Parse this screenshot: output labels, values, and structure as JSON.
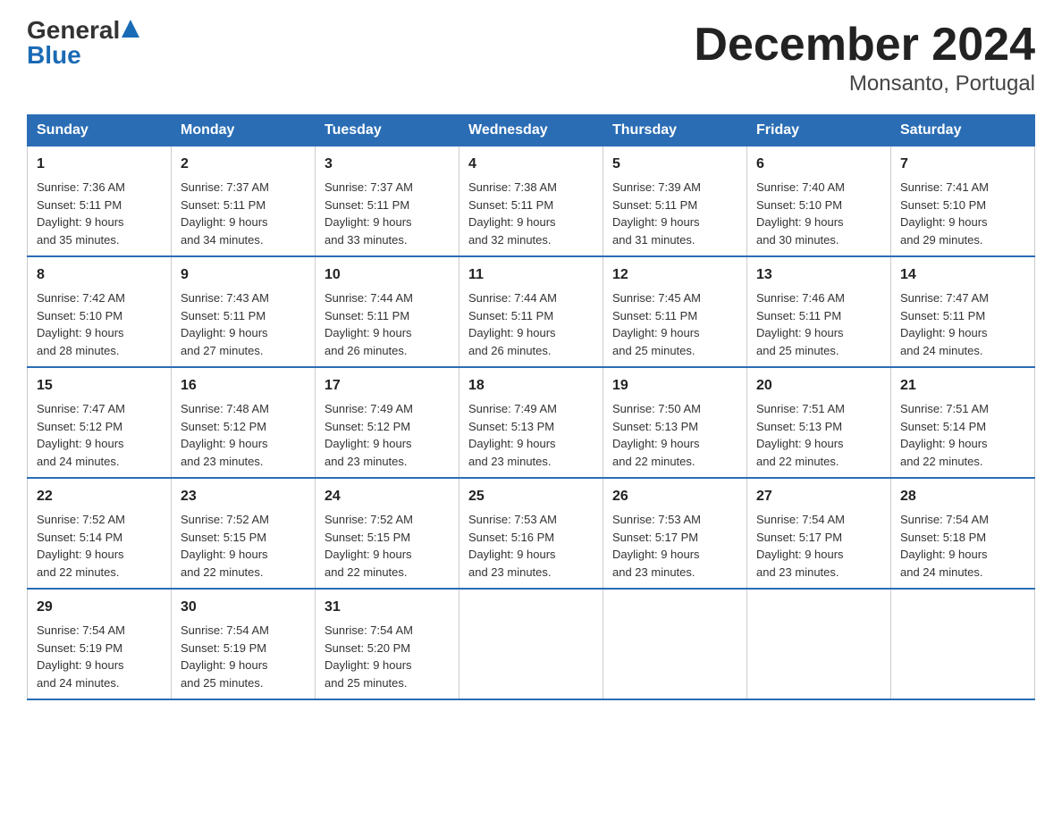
{
  "logo": {
    "general": "General",
    "blue": "Blue"
  },
  "title": "December 2024",
  "subtitle": "Monsanto, Portugal",
  "headers": [
    "Sunday",
    "Monday",
    "Tuesday",
    "Wednesday",
    "Thursday",
    "Friday",
    "Saturday"
  ],
  "weeks": [
    [
      {
        "day": "1",
        "sunrise": "7:36 AM",
        "sunset": "5:11 PM",
        "daylight": "9 hours and 35 minutes."
      },
      {
        "day": "2",
        "sunrise": "7:37 AM",
        "sunset": "5:11 PM",
        "daylight": "9 hours and 34 minutes."
      },
      {
        "day": "3",
        "sunrise": "7:37 AM",
        "sunset": "5:11 PM",
        "daylight": "9 hours and 33 minutes."
      },
      {
        "day": "4",
        "sunrise": "7:38 AM",
        "sunset": "5:11 PM",
        "daylight": "9 hours and 32 minutes."
      },
      {
        "day": "5",
        "sunrise": "7:39 AM",
        "sunset": "5:11 PM",
        "daylight": "9 hours and 31 minutes."
      },
      {
        "day": "6",
        "sunrise": "7:40 AM",
        "sunset": "5:10 PM",
        "daylight": "9 hours and 30 minutes."
      },
      {
        "day": "7",
        "sunrise": "7:41 AM",
        "sunset": "5:10 PM",
        "daylight": "9 hours and 29 minutes."
      }
    ],
    [
      {
        "day": "8",
        "sunrise": "7:42 AM",
        "sunset": "5:10 PM",
        "daylight": "9 hours and 28 minutes."
      },
      {
        "day": "9",
        "sunrise": "7:43 AM",
        "sunset": "5:11 PM",
        "daylight": "9 hours and 27 minutes."
      },
      {
        "day": "10",
        "sunrise": "7:44 AM",
        "sunset": "5:11 PM",
        "daylight": "9 hours and 26 minutes."
      },
      {
        "day": "11",
        "sunrise": "7:44 AM",
        "sunset": "5:11 PM",
        "daylight": "9 hours and 26 minutes."
      },
      {
        "day": "12",
        "sunrise": "7:45 AM",
        "sunset": "5:11 PM",
        "daylight": "9 hours and 25 minutes."
      },
      {
        "day": "13",
        "sunrise": "7:46 AM",
        "sunset": "5:11 PM",
        "daylight": "9 hours and 25 minutes."
      },
      {
        "day": "14",
        "sunrise": "7:47 AM",
        "sunset": "5:11 PM",
        "daylight": "9 hours and 24 minutes."
      }
    ],
    [
      {
        "day": "15",
        "sunrise": "7:47 AM",
        "sunset": "5:12 PM",
        "daylight": "9 hours and 24 minutes."
      },
      {
        "day": "16",
        "sunrise": "7:48 AM",
        "sunset": "5:12 PM",
        "daylight": "9 hours and 23 minutes."
      },
      {
        "day": "17",
        "sunrise": "7:49 AM",
        "sunset": "5:12 PM",
        "daylight": "9 hours and 23 minutes."
      },
      {
        "day": "18",
        "sunrise": "7:49 AM",
        "sunset": "5:13 PM",
        "daylight": "9 hours and 23 minutes."
      },
      {
        "day": "19",
        "sunrise": "7:50 AM",
        "sunset": "5:13 PM",
        "daylight": "9 hours and 22 minutes."
      },
      {
        "day": "20",
        "sunrise": "7:51 AM",
        "sunset": "5:13 PM",
        "daylight": "9 hours and 22 minutes."
      },
      {
        "day": "21",
        "sunrise": "7:51 AM",
        "sunset": "5:14 PM",
        "daylight": "9 hours and 22 minutes."
      }
    ],
    [
      {
        "day": "22",
        "sunrise": "7:52 AM",
        "sunset": "5:14 PM",
        "daylight": "9 hours and 22 minutes."
      },
      {
        "day": "23",
        "sunrise": "7:52 AM",
        "sunset": "5:15 PM",
        "daylight": "9 hours and 22 minutes."
      },
      {
        "day": "24",
        "sunrise": "7:52 AM",
        "sunset": "5:15 PM",
        "daylight": "9 hours and 22 minutes."
      },
      {
        "day": "25",
        "sunrise": "7:53 AM",
        "sunset": "5:16 PM",
        "daylight": "9 hours and 23 minutes."
      },
      {
        "day": "26",
        "sunrise": "7:53 AM",
        "sunset": "5:17 PM",
        "daylight": "9 hours and 23 minutes."
      },
      {
        "day": "27",
        "sunrise": "7:54 AM",
        "sunset": "5:17 PM",
        "daylight": "9 hours and 23 minutes."
      },
      {
        "day": "28",
        "sunrise": "7:54 AM",
        "sunset": "5:18 PM",
        "daylight": "9 hours and 24 minutes."
      }
    ],
    [
      {
        "day": "29",
        "sunrise": "7:54 AM",
        "sunset": "5:19 PM",
        "daylight": "9 hours and 24 minutes."
      },
      {
        "day": "30",
        "sunrise": "7:54 AM",
        "sunset": "5:19 PM",
        "daylight": "9 hours and 25 minutes."
      },
      {
        "day": "31",
        "sunrise": "7:54 AM",
        "sunset": "5:20 PM",
        "daylight": "9 hours and 25 minutes."
      },
      null,
      null,
      null,
      null
    ]
  ]
}
